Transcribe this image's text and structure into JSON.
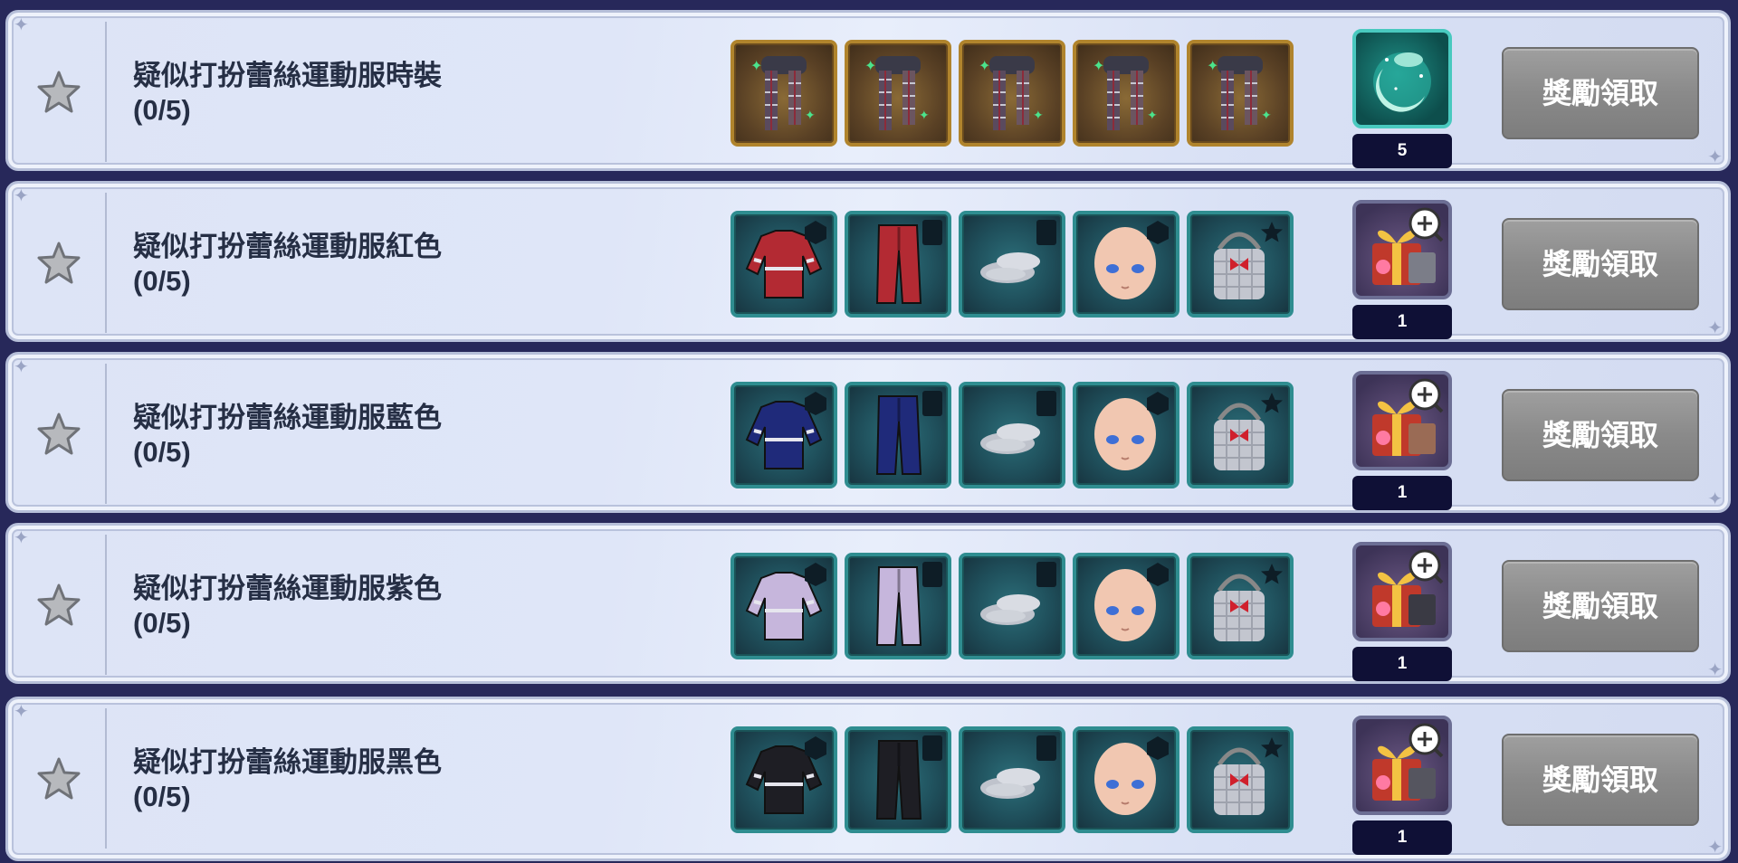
{
  "missions": [
    {
      "title": "疑似打扮蕾絲運動服時裝",
      "progress": "(0/5)",
      "item_style": "gold",
      "items": [
        "plaid-scarf-icon",
        "plaid-scarf-icon",
        "plaid-scarf-icon",
        "plaid-scarf-icon",
        "plaid-scarf-icon"
      ],
      "reward_icon": "moon-crescent-icon",
      "reward_count": "5",
      "claim_label": "獎勵領取"
    },
    {
      "title": "疑似打扮蕾絲運動服紅色",
      "progress": "(0/5)",
      "item_style": "teal",
      "items": [
        "sweater-icon",
        "pants-icon",
        "shoes-icon",
        "face-icon",
        "tote-bag-icon"
      ],
      "color": "#b32a33",
      "reward_icon": "gift-box-icon",
      "reward_count": "1",
      "claim_label": "獎勵領取"
    },
    {
      "title": "疑似打扮蕾絲運動服藍色",
      "progress": "(0/5)",
      "item_style": "teal",
      "items": [
        "sweater-icon",
        "pants-icon",
        "shoes-icon",
        "face-icon",
        "tote-bag-icon"
      ],
      "color": "#1f2a7a",
      "reward_icon": "gift-box-icon",
      "reward_count": "1",
      "claim_label": "獎勵領取"
    },
    {
      "title": "疑似打扮蕾絲運動服紫色",
      "progress": "(0/5)",
      "item_style": "teal",
      "items": [
        "sweater-icon",
        "pants-icon",
        "shoes-icon",
        "face-icon",
        "tote-bag-icon"
      ],
      "color": "#c6b6dc",
      "reward_icon": "gift-box-icon",
      "reward_count": "1",
      "claim_label": "獎勵領取"
    },
    {
      "title": "疑似打扮蕾絲運動服黑色",
      "progress": "(0/5)",
      "item_style": "teal",
      "items": [
        "sweater-icon",
        "pants-icon",
        "shoes-icon",
        "face-icon",
        "tote-bag-icon"
      ],
      "color": "#1e1e24",
      "reward_icon": "gift-box-icon",
      "reward_count": "1",
      "claim_label": "獎勵領取"
    }
  ]
}
